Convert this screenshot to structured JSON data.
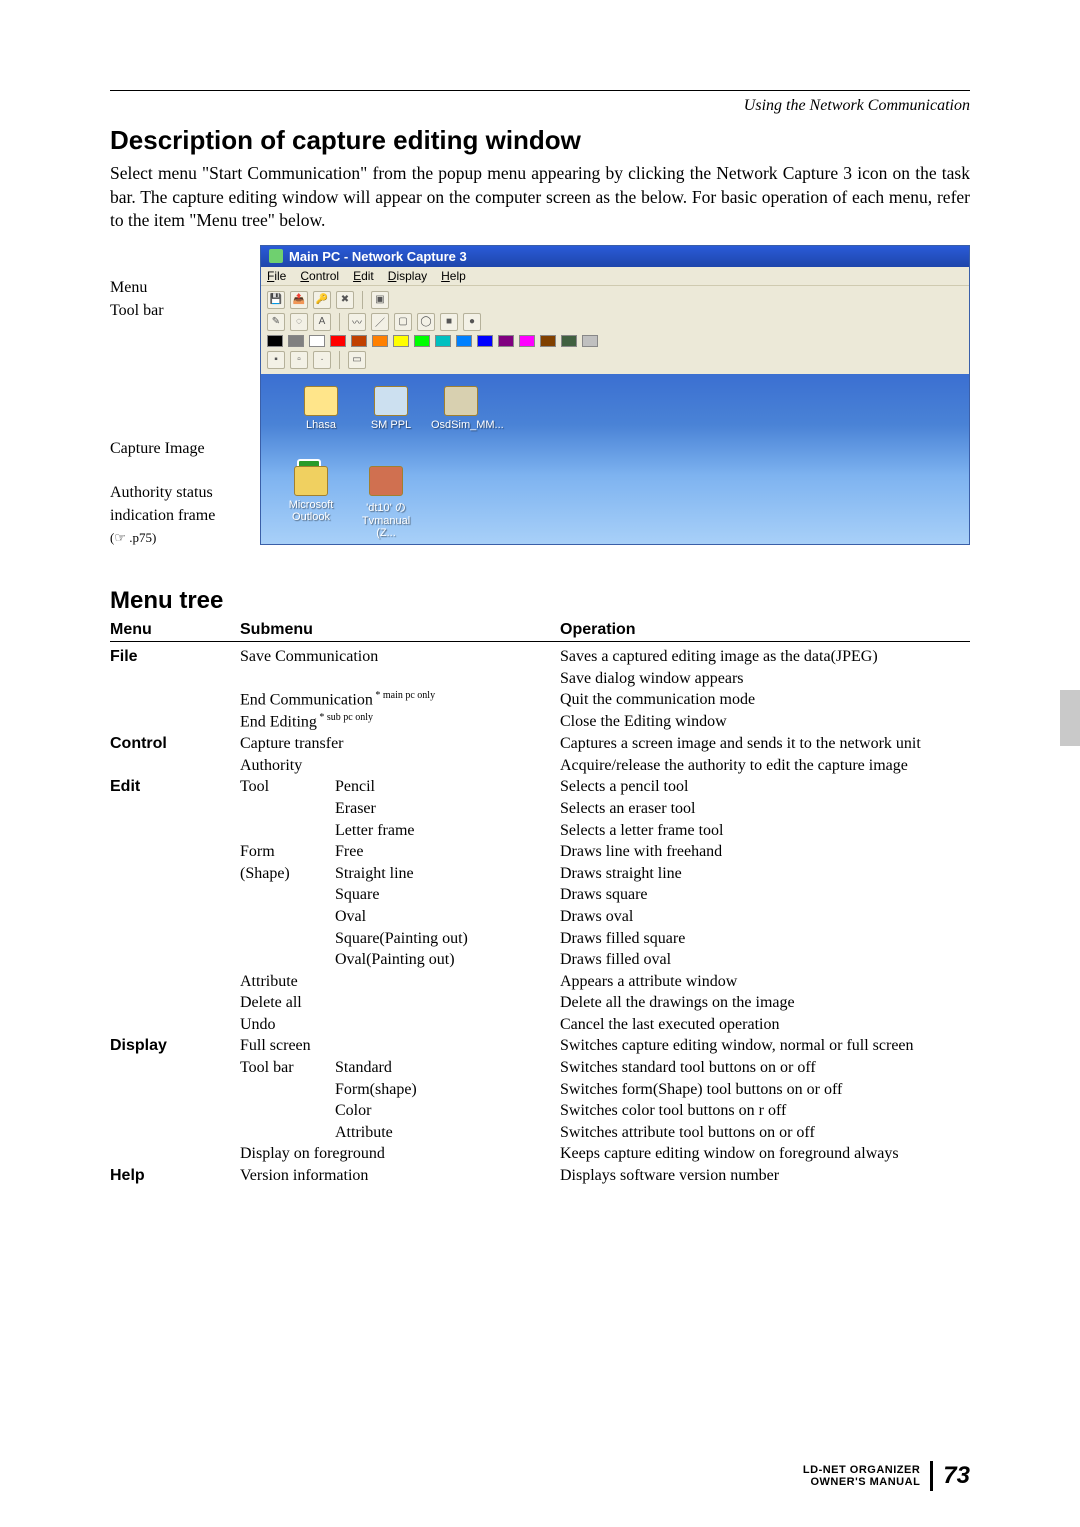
{
  "header_context": "Using the Network Communication",
  "section_title": "Description of capture editing window",
  "intro": "Select menu \"Start Communication\" from the popup menu appearing by clicking  the Network Capture 3 icon on the task bar. The capture editing window will appear on the computer screen as the below. For basic operation of each menu, refer to the item \"Menu tree\" below.",
  "labels": {
    "menu": "Menu",
    "toolbar": "Tool bar",
    "capture_image": "Capture Image",
    "auth1": "Authority status",
    "auth2": "indication frame",
    "auth3": "(☞ .p75)"
  },
  "window": {
    "title": "Main PC - Network Capture 3",
    "menus": [
      "File",
      "Control",
      "Edit",
      "Display",
      "Help"
    ],
    "desktop_icons": [
      {
        "label": "Lhasa"
      },
      {
        "label": "SM PPL"
      },
      {
        "label": "OsdSim_MM..."
      },
      {
        "label": "Microsoft Outlook"
      },
      {
        "label": "'dt10' の Tvmanual (Z..."
      }
    ]
  },
  "tree_title": "Menu tree",
  "tree_headers": {
    "menu": "Menu",
    "submenu": "Submenu",
    "operation": "Operation"
  },
  "tree": [
    {
      "menu": "File",
      "sub": "Save Communication",
      "op": "Saves a captured editing image as the data(JPEG)"
    },
    {
      "menu": "",
      "sub": "",
      "op": "Save dialog window appears"
    },
    {
      "menu": "",
      "sub": "End Communication",
      "note": "* main pc only",
      "op": "Quit the communication mode"
    },
    {
      "menu": "",
      "sub": "End Editing",
      "note": "* sub pc only",
      "op": "Close the Editing window"
    },
    {
      "menu": "Control",
      "sub": "Capture transfer",
      "op": "Captures a screen image and sends it to the network unit"
    },
    {
      "menu": "",
      "sub": "Authority",
      "op": "Acquire/release the authority to edit the capture image"
    },
    {
      "menu": "Edit",
      "sub": "Tool",
      "sub2": "Pencil",
      "op": "Selects a pencil tool"
    },
    {
      "menu": "",
      "sub": "",
      "sub2": "Eraser",
      "op": "Selects an eraser tool"
    },
    {
      "menu": "",
      "sub": "",
      "sub2": "Letter frame",
      "op": "Selects a letter frame tool"
    },
    {
      "menu": "",
      "sub": "Form",
      "sub2": "Free",
      "op": "Draws line with freehand"
    },
    {
      "menu": "",
      "sub": "(Shape)",
      "sub2": "Straight line",
      "op": "Draws straight line"
    },
    {
      "menu": "",
      "sub": "",
      "sub2": "Square",
      "op": "Draws square"
    },
    {
      "menu": "",
      "sub": "",
      "sub2": "Oval",
      "op": "Draws oval"
    },
    {
      "menu": "",
      "sub": "",
      "sub2": "Square(Painting out)",
      "op": "Draws filled square"
    },
    {
      "menu": "",
      "sub": "",
      "sub2": "Oval(Painting out)",
      "op": "Draws filled oval"
    },
    {
      "menu": "",
      "sub": "Attribute",
      "op": "Appears a attribute window"
    },
    {
      "menu": "",
      "sub": "Delete all",
      "op": "Delete all the drawings on the image"
    },
    {
      "menu": "",
      "sub": "Undo",
      "op": "Cancel the last executed operation"
    },
    {
      "menu": "Display",
      "sub": "Full screen",
      "op": "Switches capture editing window, normal or full screen"
    },
    {
      "menu": "",
      "sub": "Tool bar",
      "sub2": "Standard",
      "op": "Switches standard tool buttons on or off"
    },
    {
      "menu": "",
      "sub": "",
      "sub2": "Form(shape)",
      "op": "Switches form(Shape) tool buttons on or off"
    },
    {
      "menu": "",
      "sub": "",
      "sub2": "Color",
      "op": "Switches color tool buttons on r off"
    },
    {
      "menu": "",
      "sub": "",
      "sub2": "Attribute",
      "op": "Switches attribute tool buttons on or off"
    },
    {
      "menu": "",
      "sub": "Display on foreground",
      "op": "Keeps capture editing window on foreground always"
    },
    {
      "menu": "Help",
      "sub": "Version information",
      "op": "Displays software version number"
    }
  ],
  "footer": {
    "line1": "LD-NET ORGANIZER",
    "line2": "OWNER'S MANUAL",
    "page": "73"
  },
  "swatches": [
    "#000000",
    "#808080",
    "#ffffff",
    "#ff0000",
    "#c04000",
    "#ff8000",
    "#ffff00",
    "#00ff00",
    "#00c0c0",
    "#0080ff",
    "#0000ff",
    "#800080",
    "#ff00ff",
    "#804000",
    "#406040",
    "#c0c0c0"
  ]
}
